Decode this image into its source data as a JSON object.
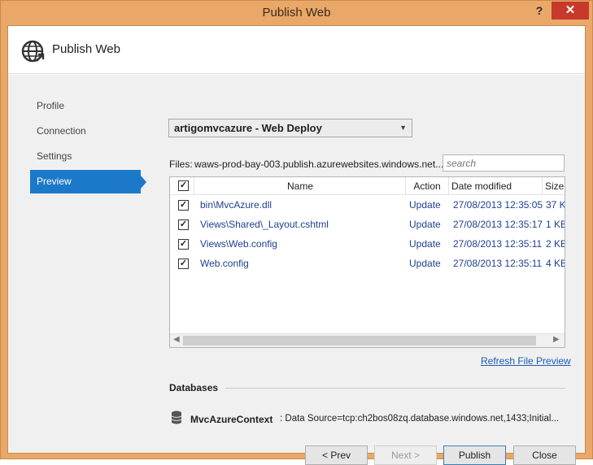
{
  "window": {
    "title": "Publish Web",
    "help_label": "?",
    "close_label": "✕"
  },
  "header": {
    "title": "Publish Web"
  },
  "nav": {
    "items": [
      {
        "label": "Profile"
      },
      {
        "label": "Connection"
      },
      {
        "label": "Settings"
      },
      {
        "label": "Preview"
      }
    ],
    "active": "Preview"
  },
  "profile": {
    "selected": "artigomvcazure - Web Deploy"
  },
  "files": {
    "label": "Files:",
    "path": "waws-prod-bay-003.publish.azurewebsites.windows.net...",
    "search_placeholder": "search"
  },
  "grid": {
    "columns": {
      "name": "Name",
      "action": "Action",
      "date_modified": "Date modified",
      "size": "Size"
    },
    "header_checked": true,
    "rows": [
      {
        "checked": true,
        "name": "bin\\MvcAzure.dll",
        "action": "Update",
        "date": "27/08/2013 12:35:05",
        "size": "37 KB"
      },
      {
        "checked": true,
        "name": "Views\\Shared\\_Layout.cshtml",
        "action": "Update",
        "date": "27/08/2013 12:35:17",
        "size": "1 KB"
      },
      {
        "checked": true,
        "name": "Views\\Web.config",
        "action": "Update",
        "date": "27/08/2013 12:35:11",
        "size": "2 KB"
      },
      {
        "checked": true,
        "name": "Web.config",
        "action": "Update",
        "date": "27/08/2013 12:35:11",
        "size": "4 KB"
      }
    ]
  },
  "refresh_link": "Refresh File Preview",
  "databases": {
    "title": "Databases",
    "items": [
      {
        "name": "MvcAzureContext",
        "connection": ": Data Source=tcp:ch2bos08zq.database.windows.net,1433;Initial..."
      }
    ]
  },
  "buttons": {
    "prev": "< Prev",
    "next": "Next >",
    "publish": "Publish",
    "close": "Close"
  },
  "colors": {
    "titlebar": "#e9a868",
    "accent": "#1c79c9",
    "close_button": "#c7392b",
    "link": "#1c5cb8",
    "row_text": "#1f3f8f"
  }
}
